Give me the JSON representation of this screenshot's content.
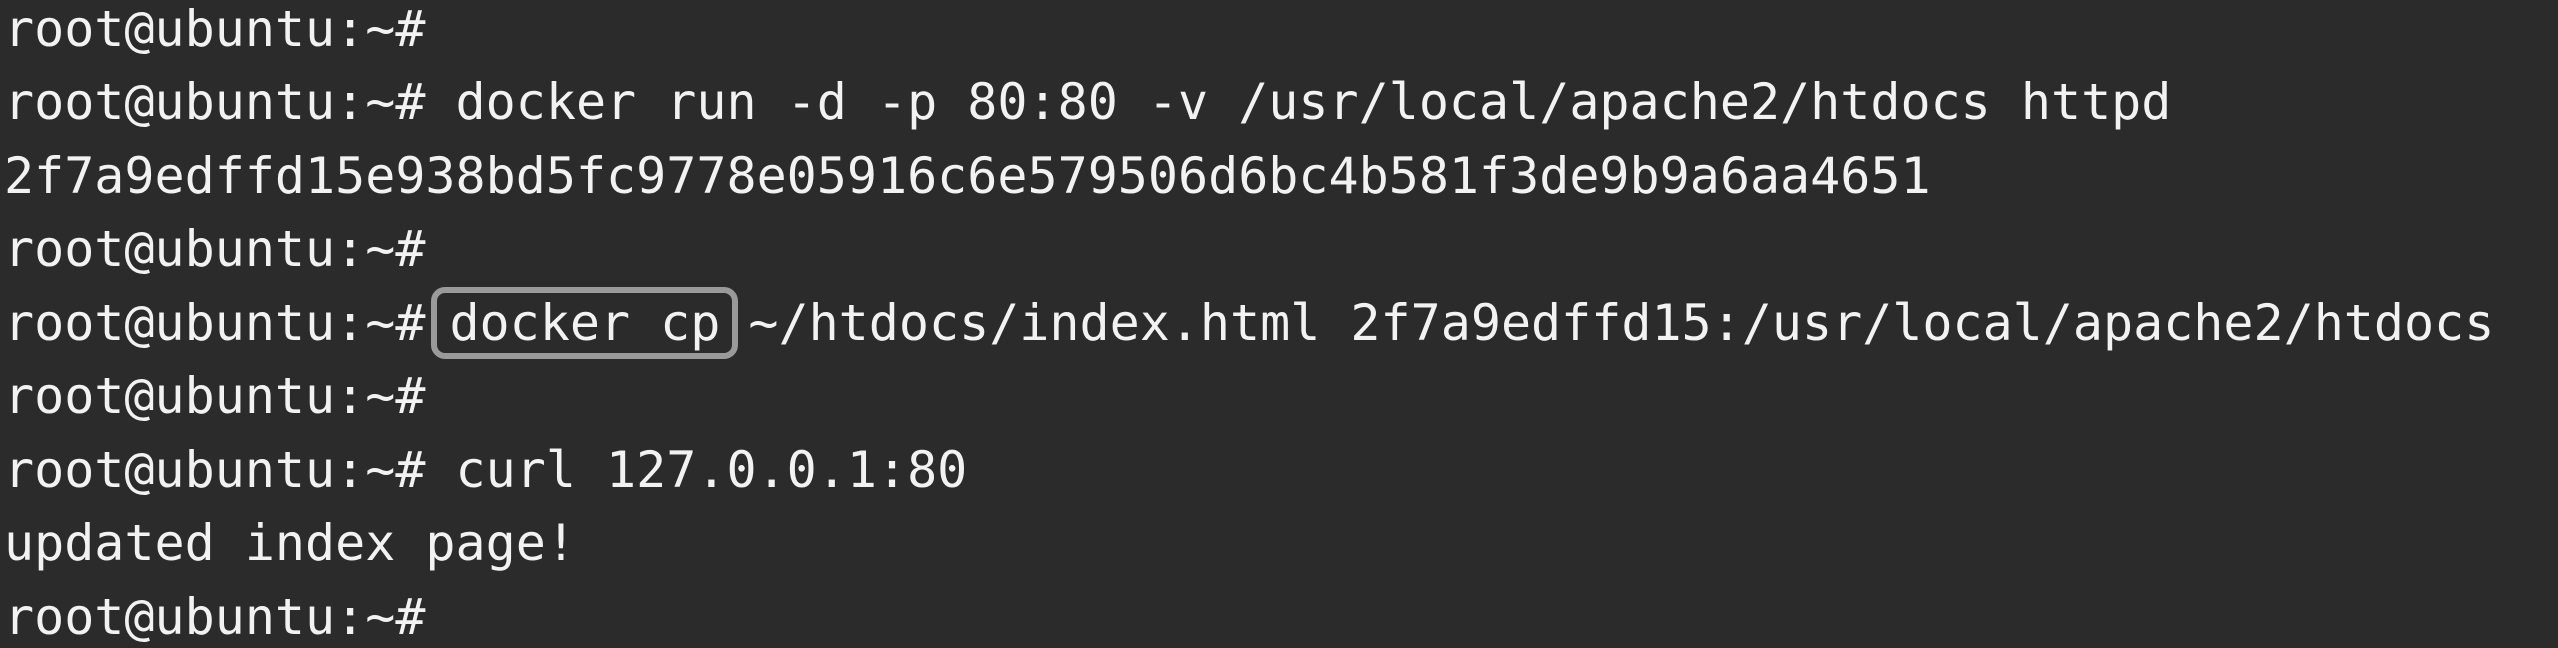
{
  "terminal": {
    "prompt": "root@ubuntu:~#",
    "lines": [
      {
        "type": "prompt",
        "command": ""
      },
      {
        "type": "prompt",
        "command": " docker run -d -p 80:80 -v /usr/local/apache2/htdocs httpd"
      },
      {
        "type": "output",
        "text": "2f7a9edffd15e938bd5fc9778e05916c6e579506d6bc4b581f3de9b9a6aa4651"
      },
      {
        "type": "prompt",
        "command": ""
      },
      {
        "type": "prompt",
        "highlighted": "docker cp",
        "command": "~/htdocs/index.html 2f7a9edffd15:/usr/local/apache2/htdocs"
      },
      {
        "type": "prompt",
        "command": ""
      },
      {
        "type": "prompt",
        "command": " curl 127.0.0.1:80"
      },
      {
        "type": "output",
        "text": "updated index page!"
      },
      {
        "type": "prompt",
        "command": ""
      }
    ]
  },
  "colors": {
    "background": "#2b2b2b",
    "text": "#f2f2f2",
    "highlight_border": "#9a9a9a"
  }
}
